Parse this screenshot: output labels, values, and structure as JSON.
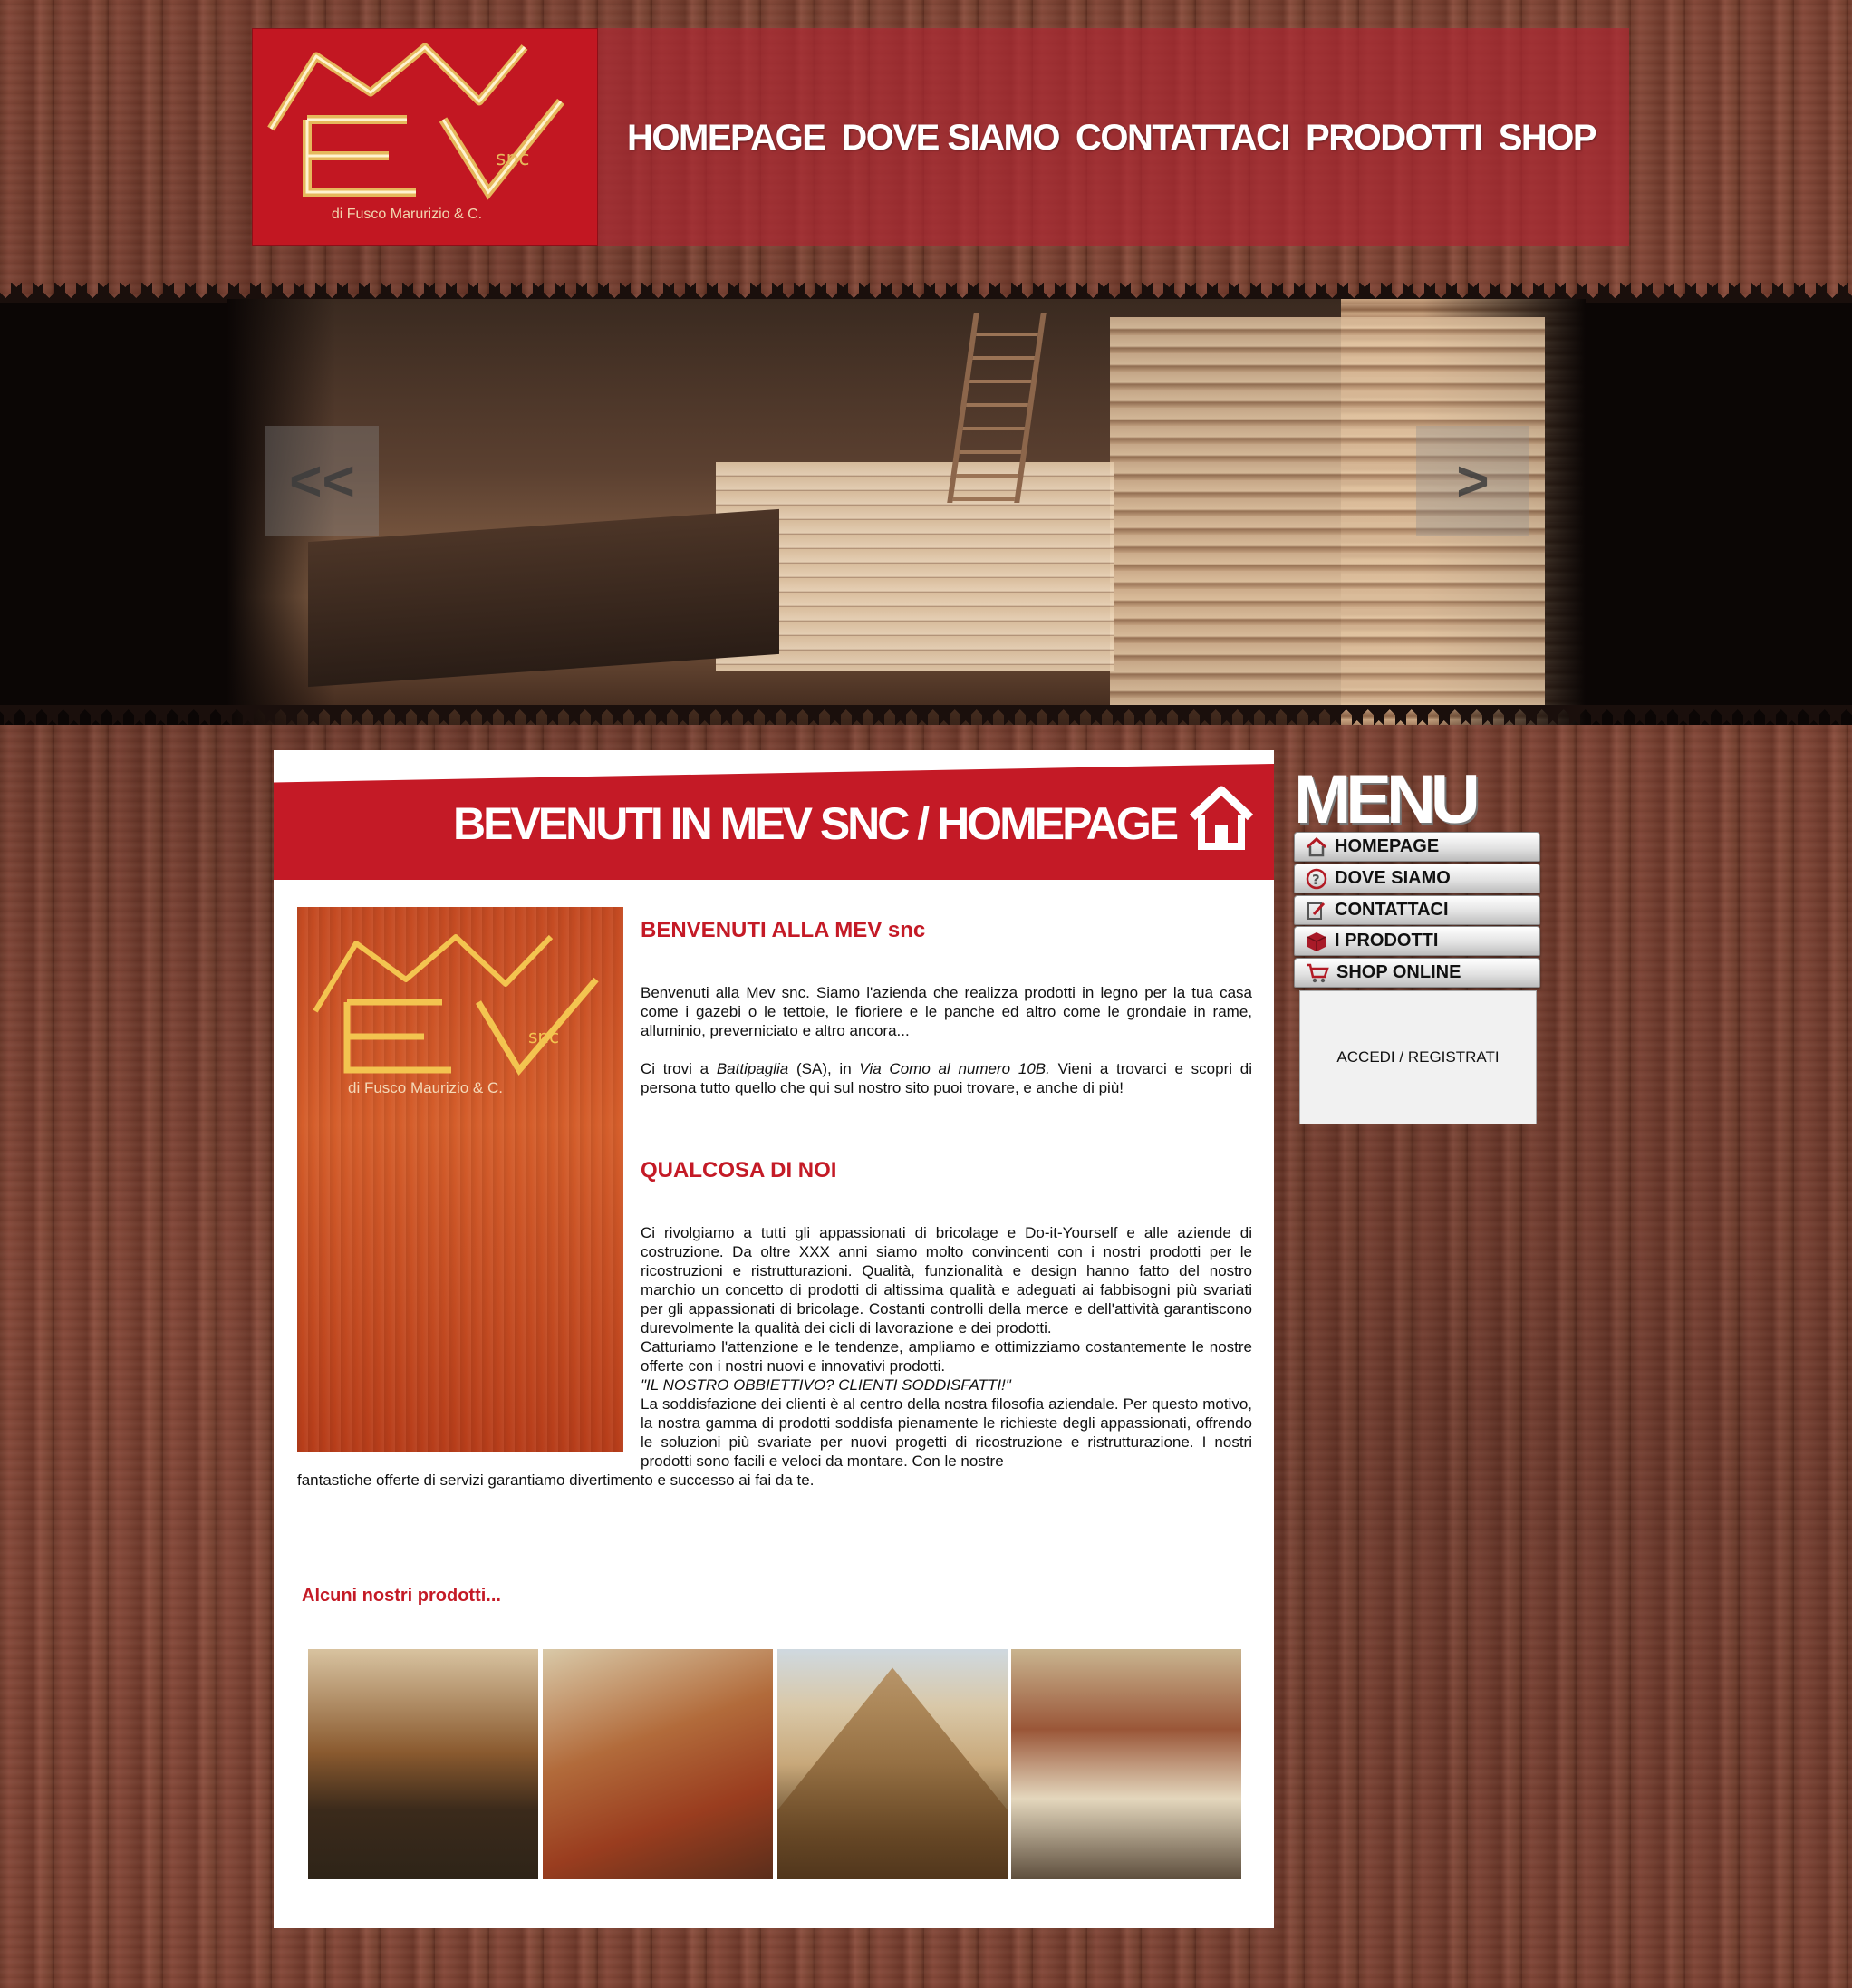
{
  "header": {
    "logo_text": "MEV",
    "logo_snc": "snc",
    "logo_sub": "di Fusco Marurizio & C.",
    "nav": [
      "HOMEPAGE",
      "DOVE SIAMO",
      "CONTATTACI",
      "PRODOTTI",
      "SHOP"
    ]
  },
  "slider": {
    "prev_label": "<<",
    "next_label": ">"
  },
  "main": {
    "page_title": "BEVENUTI IN MEV SNC / HOMEPAGE",
    "side_logo_sub": "di Fusco Maurizio & C.",
    "welcome_heading": "BENVENUTI ALLA MEV snc",
    "welcome_p1": "Benvenuti alla Mev snc. Siamo l'azienda che realizza prodotti in legno per la tua casa come i gazebi o le tettoie, le fioriere e le panche ed altro come le grondaie in rame, alluminio, preverniciato e altro ancora...",
    "welcome_p2_a": "Ci trovi a ",
    "welcome_p2_city": "Battipaglia",
    "welcome_p2_b": " (SA), in ",
    "welcome_p2_street": "Via Como al numero 10B.",
    "welcome_p2_c": " Vieni a trovarci e scopri di persona tutto quello che qui sul nostro sito puoi trovare, e anche di più!",
    "about_heading": "QUALCOSA DI NOI",
    "about_p1": "Ci rivolgiamo a tutti gli appassionati di bricolage e Do-it-Yourself e alle aziende di costruzione. Da oltre XXX anni siamo molto convincenti con i nostri prodotti per le ricostruzioni e ristrutturazioni. Qualità, funzionalità e design hanno fatto del nostro marchio un concetto di prodotti di altissima qualità e adeguati ai fabbisogni più svariati per gli appassionati di bricolage. Costanti controlli della merce e dell'attività garantiscono durevolmente la qualità dei cicli di lavorazione e dei prodotti.",
    "about_p2": "Catturiamo l'attenzione e le tendenze, ampliamo e ottimizziamo costantemente le nostre offerte con i nostri nuovi e innovativi prodotti.",
    "about_quote": "\"IL NOSTRO OBBIETTIVO? CLIENTI SODDISFATTI!\"",
    "about_p3a": "La soddisfazione dei clienti è al centro della nostra filosofia aziendale. Per questo motivo, la nostra gamma di prodotti soddisfa pienamente le richieste degli appassionati, offrendo le soluzioni più svariate per nuovi progetti di ricostruzione e ristrutturazione. I nostri prodotti sono facili e veloci da montare. Con le nostre",
    "about_p3b": "fantastiche offerte di servizi garantiamo divertimento e successo ai fai da te.",
    "products_heading": "Alcuni nostri prodotti..."
  },
  "sidebar": {
    "menu_title": "MENU",
    "items": [
      {
        "label": "HOMEPAGE",
        "icon": "home-icon"
      },
      {
        "label": "DOVE SIAMO",
        "icon": "question-icon"
      },
      {
        "label": "CONTATTACI",
        "icon": "edit-icon"
      },
      {
        "label": "I PRODOTTI",
        "icon": "box-icon"
      },
      {
        "label": "SHOP ONLINE",
        "icon": "cart-icon"
      }
    ],
    "login_label": "ACCEDI / REGISTRATI"
  },
  "colors": {
    "accent_red": "#c41a26",
    "wood": "#7a4233"
  }
}
